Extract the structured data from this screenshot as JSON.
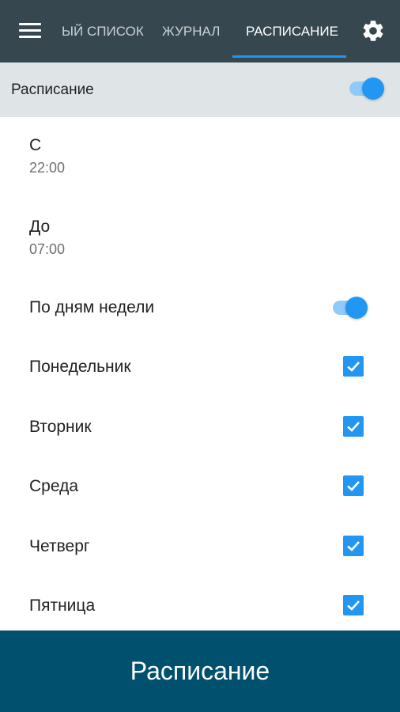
{
  "topbar": {
    "tabs": [
      {
        "label": "ЫЙ СПИСОК"
      },
      {
        "label": "ЖУРНАЛ"
      },
      {
        "label": "РАСПИСАНИЕ"
      }
    ],
    "active_tab": 2,
    "menu_icon": "menu-icon",
    "settings_icon": "gear-icon",
    "bg_color": "#37474f",
    "accent": "#2196f3"
  },
  "header": {
    "title": "Расписание",
    "enabled": true
  },
  "from": {
    "title": "С",
    "value": "22:00"
  },
  "to": {
    "title": "До",
    "value": "07:00"
  },
  "weekdays": {
    "label": "По дням недели",
    "enabled": true,
    "days": [
      {
        "label": "Понедельник",
        "checked": true
      },
      {
        "label": "Вторник",
        "checked": true
      },
      {
        "label": "Среда",
        "checked": true
      },
      {
        "label": "Четверг",
        "checked": true
      },
      {
        "label": "Пятница",
        "checked": true
      }
    ]
  },
  "bottom": {
    "label": "Расписание",
    "bg_color": "#00506e"
  }
}
